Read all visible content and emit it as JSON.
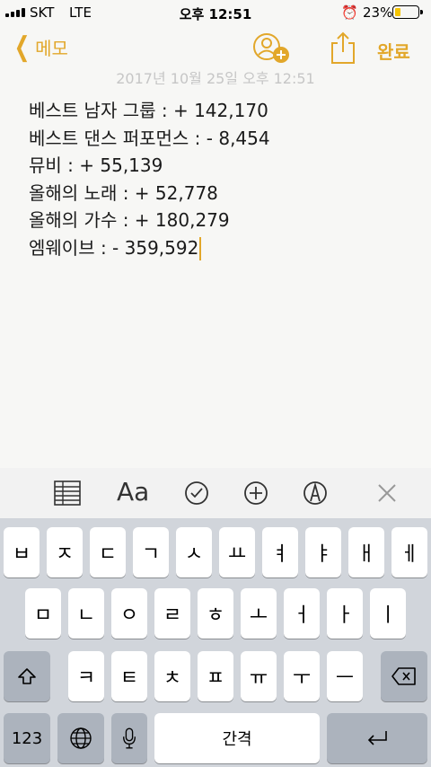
{
  "status": {
    "carrier": "SKT",
    "network": "LTE",
    "time": "오후 12:51",
    "battery": "23%",
    "battery_level": 0.23
  },
  "nav": {
    "back_label": "메모",
    "done_label": "완료"
  },
  "note": {
    "date": "2017년 10월 25일 오후 12:51",
    "lines": [
      "베스트 남자 그룹 : + 142,170",
      "베스트 댄스 퍼포먼스 : - 8,454",
      "뮤비 : + 55,139",
      "올해의 노래 : + 52,778",
      "올해의 가수 : + 180,279",
      "엠웨이브 : - 359,592"
    ]
  },
  "toolbar": {
    "format_label": "Aa"
  },
  "keyboard": {
    "row1": [
      "ㅂ",
      "ㅈ",
      "ㄷ",
      "ㄱ",
      "ㅅ",
      "ㅛ",
      "ㅕ",
      "ㅑ",
      "ㅐ",
      "ㅔ"
    ],
    "row2": [
      "ㅁ",
      "ㄴ",
      "ㅇ",
      "ㄹ",
      "ㅎ",
      "ㅗ",
      "ㅓ",
      "ㅏ",
      "ㅣ"
    ],
    "row3": [
      "ㅋ",
      "ㅌ",
      "ㅊ",
      "ㅍ",
      "ㅠ",
      "ㅜ",
      "ㅡ"
    ],
    "numbers_label": "123",
    "space_label": "간격"
  },
  "colors": {
    "accent": "#e2a72a",
    "keyboard_bg": "#d1d5db",
    "battery_fill": "#f5c400"
  }
}
